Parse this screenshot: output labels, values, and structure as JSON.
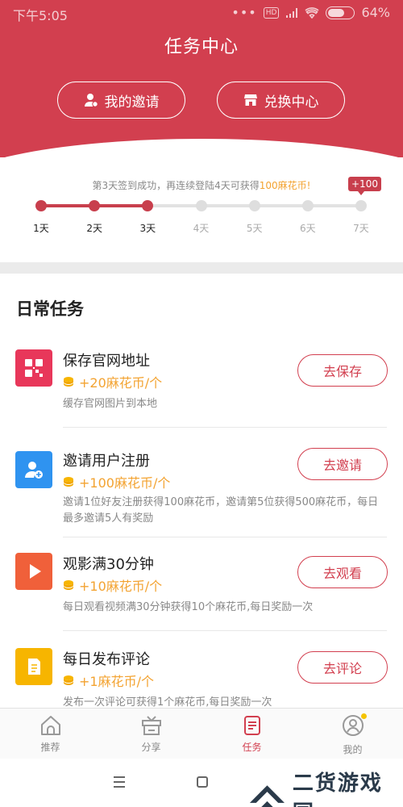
{
  "status_bar": {
    "time": "下午5:05",
    "signal_dots": "•••",
    "network_badge": "HD",
    "battery_percent": 64,
    "battery_text": "64%"
  },
  "header": {
    "title": "任务中心",
    "invite_button": "我的邀请",
    "exchange_button": "兑换中心",
    "bg_color": "#d23f4f"
  },
  "signin": {
    "message_prefix": "第3天签到成功，再连续登陆4天可获得",
    "message_highlight": "100麻花币!",
    "bonus_tag": "+100",
    "days": [
      "1天",
      "2天",
      "3天",
      "4天",
      "5天",
      "6天",
      "7天"
    ],
    "completed_days": 3
  },
  "daily": {
    "title": "日常任务",
    "tasks": [
      {
        "icon": "qrcode-icon",
        "color": "#e8375a",
        "name": "保存官网地址",
        "reward": "+20麻花币/个",
        "desc": "缓存官网图片到本地",
        "button": "去保存"
      },
      {
        "icon": "add-user-icon",
        "color": "#2f93f0",
        "name": "邀请用户注册",
        "reward": "+100麻花币/个",
        "desc": "邀请1位好友注册获得100麻花币，邀请第5位获得500麻花币，每日最多邀请5人有奖励",
        "button": "去邀请"
      },
      {
        "icon": "play-icon",
        "color": "#f0603a",
        "name": "观影满30分钟",
        "reward": "+10麻花币/个",
        "desc": "每日观看视频满30分钟获得10个麻花币,每日奖励一次",
        "button": "去观看"
      },
      {
        "icon": "document-icon",
        "color": "#f7b500",
        "name": "每日发布评论",
        "reward": "+1麻花币/个",
        "desc": "发布一次评论可获得1个麻花币,每日奖励一次",
        "button": "去评论"
      }
    ]
  },
  "nav": {
    "items": [
      {
        "label": "推荐",
        "icon": "home-icon"
      },
      {
        "label": "分享",
        "icon": "gift-icon"
      },
      {
        "label": "任务",
        "icon": "task-icon"
      },
      {
        "label": "我的",
        "icon": "profile-icon"
      }
    ],
    "active": "任务"
  },
  "watermark": {
    "text": "二货游戏园"
  }
}
